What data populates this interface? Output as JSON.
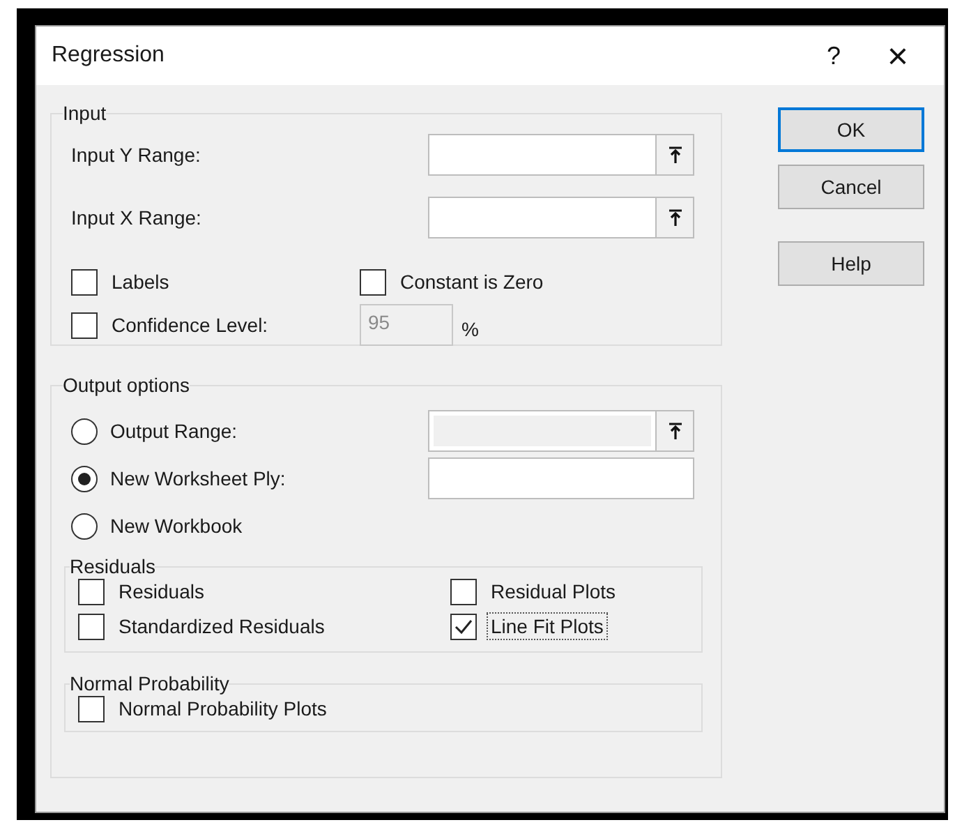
{
  "window": {
    "title": "Regression",
    "help": "?",
    "close": "×"
  },
  "input": {
    "title": "Input",
    "ranges": [
      {
        "label": "Input Y Range:"
      },
      {
        "label": "Input X Range:"
      }
    ],
    "options": [
      {
        "label": "Labels",
        "checked": false
      },
      {
        "label": "Constant is Zero",
        "checked": false
      }
    ],
    "confidence": {
      "label": "Confidence Level:",
      "checked": false,
      "value": "95",
      "unit": "%",
      "disabled": true
    }
  },
  "buttons": [
    {
      "label": "OK",
      "default": true
    },
    {
      "label": "Cancel",
      "default": false
    },
    {
      "label": "Help",
      "default": false
    }
  ],
  "output": {
    "title": "Output options",
    "choices": [
      {
        "label": "Output Range:",
        "selected": false,
        "kind": "range",
        "disabled": true
      },
      {
        "label": "New Worksheet Ply:",
        "selected": true,
        "kind": "text",
        "disabled": false
      },
      {
        "label": "New Workbook",
        "selected": false,
        "kind": "plain"
      }
    ],
    "residuals": {
      "title": "Residuals",
      "options": [
        {
          "label": "Residuals",
          "checked": false,
          "focused": false
        },
        {
          "label": "Residual Plots",
          "checked": false,
          "focused": false
        },
        {
          "label": "Standardized Residuals",
          "checked": false,
          "focused": false
        },
        {
          "label": "Line Fit Plots",
          "checked": true,
          "focused": true
        }
      ]
    },
    "normal": {
      "title": "Normal Probability",
      "options": [
        {
          "label": "Normal Probability Plots",
          "checked": false,
          "focused": false
        }
      ]
    }
  }
}
